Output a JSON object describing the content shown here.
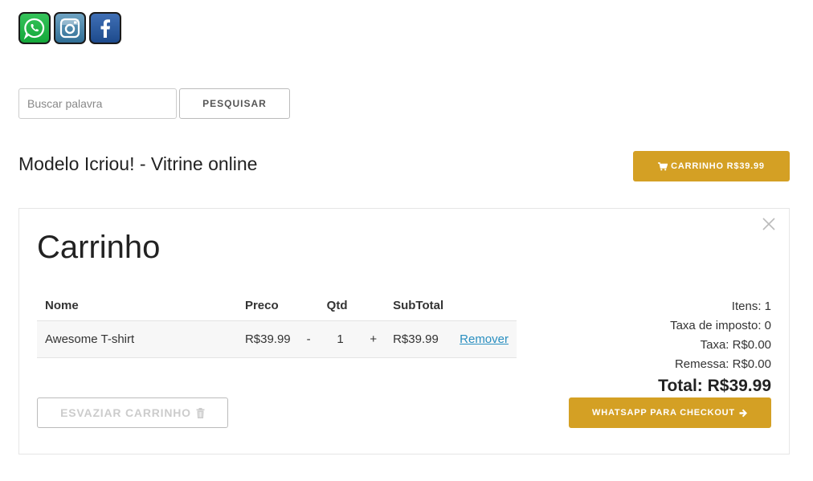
{
  "social": {
    "icons": [
      "whatsapp-icon",
      "instagram-icon",
      "facebook-icon"
    ],
    "colors": {
      "whatsapp": "#1fb141",
      "instagram": "#3a7aa3",
      "facebook": "#2a5ca5"
    }
  },
  "search": {
    "placeholder": "Buscar palavra",
    "value": "",
    "button_label": "PESQUISAR"
  },
  "header": {
    "store_title": "Modelo Icriou! - Vitrine online",
    "cart_button_label": "CARRINHO R$39.99",
    "cart_icon": "cart-icon"
  },
  "cart": {
    "heading": "Carrinho",
    "columns": {
      "name": "Nome",
      "price": "Preco",
      "qty": "Qtd",
      "subtotal": "SubTotal"
    },
    "items": [
      {
        "name": "Awesome T-shirt",
        "price": "R$39.99",
        "decrement": "-",
        "qty": "1",
        "increment": "+",
        "subtotal": "R$39.99",
        "remove_label": "Remover"
      }
    ],
    "summary": {
      "items": "Itens: 1",
      "tax_rate": "Taxa de imposto: 0",
      "tax": "Taxa: R$0.00",
      "shipping": "Remessa: R$0.00",
      "total": "Total: R$39.99"
    },
    "empty_button_label": "ESVAZIAR CARRINHO",
    "checkout_button_label": "WHATSAPP PARA CHECKOUT",
    "accent_color": "#d4a024"
  }
}
